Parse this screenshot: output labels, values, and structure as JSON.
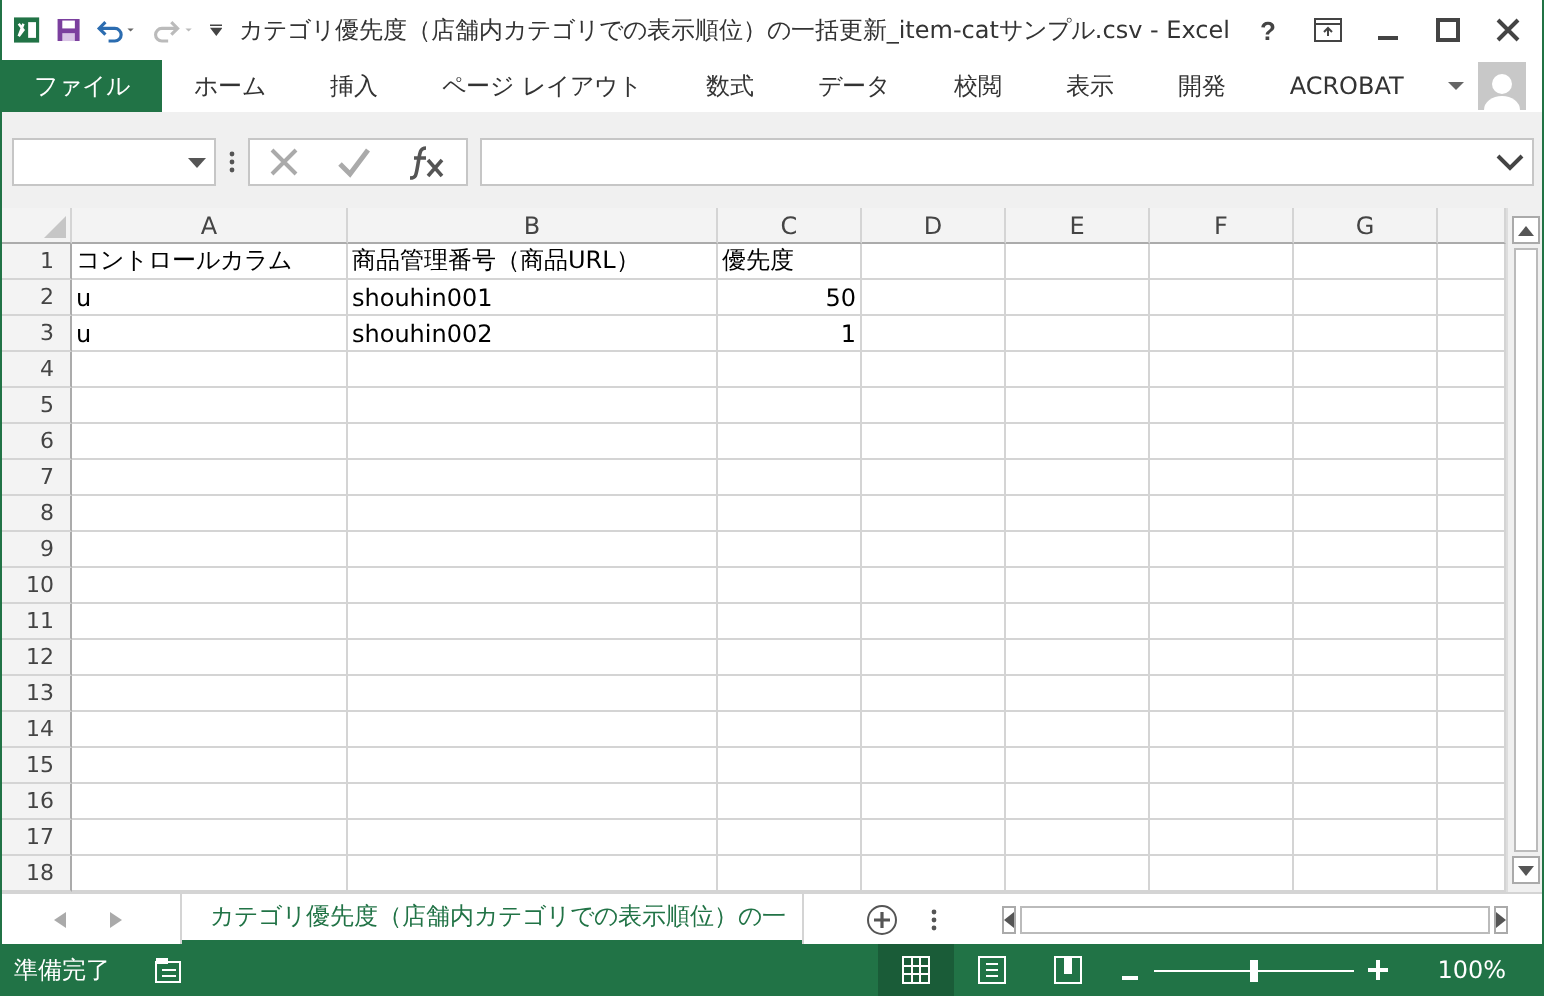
{
  "window": {
    "title": "カテゴリ優先度（店舗内カテゴリでの表示順位）の一括更新_item-catサンプル.csv - Excel",
    "help": "?"
  },
  "ribbon_tabs": [
    {
      "label": "ファイル",
      "selected": true
    },
    {
      "label": "ホーム",
      "selected": false
    },
    {
      "label": "挿入",
      "selected": false
    },
    {
      "label": "ページ レイアウト",
      "selected": false
    },
    {
      "label": "数式",
      "selected": false
    },
    {
      "label": "データ",
      "selected": false
    },
    {
      "label": "校閲",
      "selected": false
    },
    {
      "label": "表示",
      "selected": false
    },
    {
      "label": "開発",
      "selected": false
    },
    {
      "label": "ACROBAT",
      "selected": false
    }
  ],
  "columns": [
    "A",
    "B",
    "C",
    "D",
    "E",
    "F",
    "G"
  ],
  "rows": [
    {
      "number": "1",
      "cells": [
        {
          "text": "コントロールカラム",
          "kind": "text"
        },
        {
          "text": "商品管理番号（商品URL）",
          "kind": "text"
        },
        {
          "text": "優先度",
          "kind": "text"
        }
      ]
    },
    {
      "number": "2",
      "cells": [
        {
          "text": "u",
          "kind": "text"
        },
        {
          "text": "shouhin001",
          "kind": "text"
        },
        {
          "text": "50",
          "kind": "number"
        }
      ]
    },
    {
      "number": "3",
      "cells": [
        {
          "text": "u",
          "kind": "text"
        },
        {
          "text": "shouhin002",
          "kind": "text"
        },
        {
          "text": "1",
          "kind": "number"
        }
      ]
    },
    {
      "number": "4"
    },
    {
      "number": "5"
    },
    {
      "number": "6"
    },
    {
      "number": "7"
    },
    {
      "number": "8"
    },
    {
      "number": "9"
    },
    {
      "number": "10"
    },
    {
      "number": "11"
    },
    {
      "number": "12"
    },
    {
      "number": "13"
    },
    {
      "number": "14"
    },
    {
      "number": "15"
    },
    {
      "number": "16"
    },
    {
      "number": "17"
    },
    {
      "number": "18"
    }
  ],
  "sheet_tabs": [
    {
      "label": "カテゴリ優先度（店舗内カテゴリでの表示順位）の一",
      "selected": true
    }
  ],
  "status_bar": {
    "status": "準備完了",
    "zoom": "100%",
    "zoom_slider": {
      "level": 0.5
    }
  }
}
